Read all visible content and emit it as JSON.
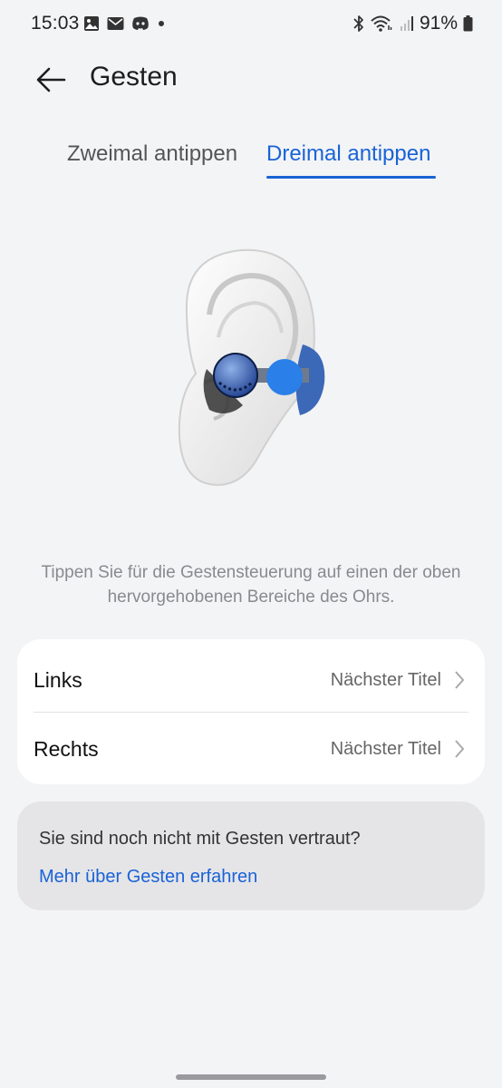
{
  "status_bar": {
    "time": "15:03",
    "left_icons": [
      "gallery-icon",
      "mail-icon",
      "discord-icon",
      "dot-icon"
    ],
    "right_icons": [
      "bluetooth-icon",
      "wifi-icon",
      "signal-icon",
      "battery-icon"
    ],
    "battery": "91%"
  },
  "header": {
    "back_icon": "arrow-left-icon",
    "title": "Gesten"
  },
  "tabs": [
    {
      "label": "Zweimal antippen",
      "selected": false
    },
    {
      "label": "Dreimal antippen",
      "selected": true
    }
  ],
  "hint": "Tippen Sie für die Gestensteuerung auf einen der oben hervorgehobenen Bereiche des Ohrs.",
  "settings": {
    "rows": [
      {
        "label": "Links",
        "value": "Nächster Titel"
      },
      {
        "label": "Rechts",
        "value": "Nächster Titel"
      }
    ]
  },
  "info": {
    "text": "Sie sind noch nicht mit Gesten vertraut?",
    "link": "Mehr über Gesten erfahren"
  },
  "colors": {
    "accent": "#1a63d6",
    "background": "#f3f4f6",
    "card": "#ffffff",
    "info_card": "#e5e5e8"
  }
}
